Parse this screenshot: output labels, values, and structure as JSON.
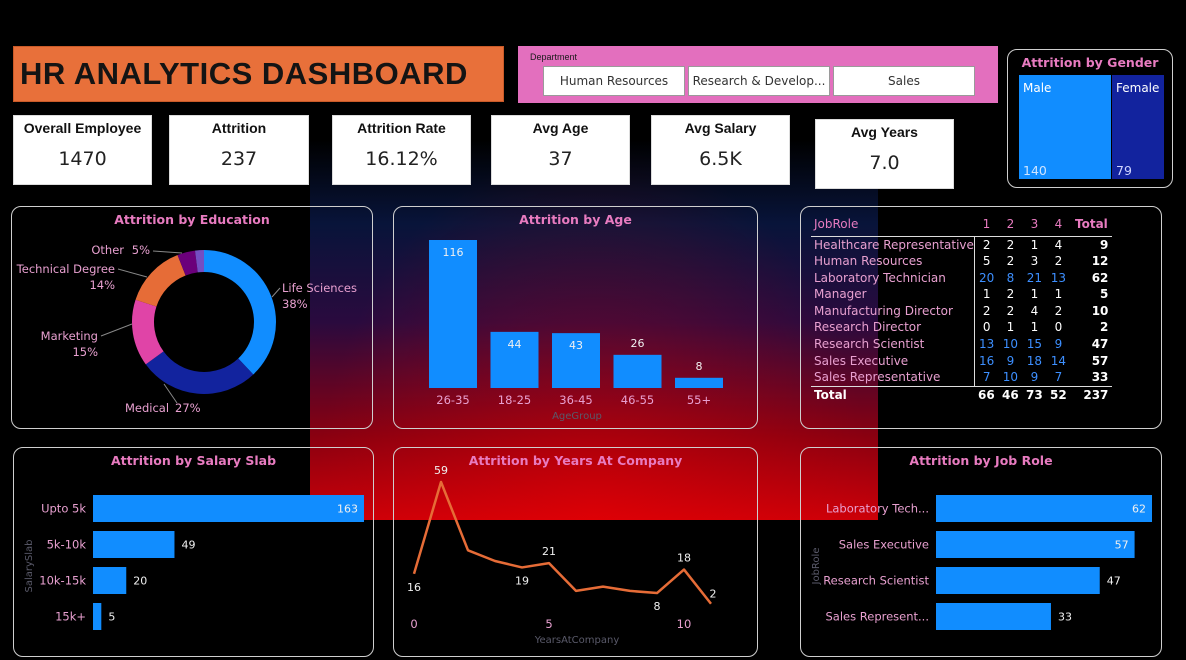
{
  "title": "HR ANALYTICS DASHBOARD",
  "department": {
    "label": "Department",
    "options": [
      "Human Resources",
      "Research & Develop...",
      "Sales"
    ]
  },
  "kpis": [
    {
      "label": "Overall Employee",
      "value": "1470"
    },
    {
      "label": "Attrition",
      "value": "237"
    },
    {
      "label": "Attrition Rate",
      "value": "16.12%"
    },
    {
      "label": "Avg Age",
      "value": "37"
    },
    {
      "label": "Avg Salary",
      "value": "6.5K"
    },
    {
      "label": "Avg Years",
      "value": "7.0"
    }
  ],
  "colors": {
    "title_bg": "#e8703a",
    "slicer_bg": "#e36fbe",
    "accent_pink": "#e87bc0",
    "bar_blue": "#118dff",
    "male_blue": "#118dff",
    "female_blue": "#12239e",
    "line_orange": "#e66c37",
    "highlight_blue": "#3d8fff"
  },
  "gender": {
    "title": "Attrition by Gender",
    "male_label": "Male",
    "male_value": "140",
    "female_label": "Female",
    "female_value": "79"
  },
  "chart_data": [
    {
      "id": "education",
      "type": "pie",
      "title": "Attrition by Education",
      "slices": [
        {
          "name": "Life Sciences",
          "label": "38%",
          "value": 38,
          "color": "#118dff"
        },
        {
          "name": "Medical",
          "label": "27%",
          "value": 27,
          "color": "#12239e"
        },
        {
          "name": "Marketing",
          "label": "15%",
          "value": 15,
          "color": "#e044a7"
        },
        {
          "name": "Technical Degree",
          "label": "14%",
          "value": 14,
          "color": "#e66c37"
        },
        {
          "name": "Other",
          "label": "5%",
          "value": 4,
          "color": "#6b007b"
        },
        {
          "name": "",
          "label": "",
          "value": 2,
          "color": "#744ec2"
        }
      ]
    },
    {
      "id": "age",
      "type": "bar",
      "title": "Attrition by Age",
      "categories": [
        "26-35",
        "18-25",
        "36-45",
        "46-55",
        "55+"
      ],
      "values": [
        116,
        44,
        43,
        26,
        8
      ],
      "xlabel": "AgeGroup",
      "ylim": [
        0,
        116
      ]
    },
    {
      "id": "salary",
      "type": "bar",
      "orientation": "horizontal",
      "title": "Attrition by Salary Slab",
      "categories": [
        "Upto 5k",
        "5k-10k",
        "10k-15k",
        "15k+"
      ],
      "values": [
        163,
        49,
        20,
        5
      ],
      "ylabel": "SalarySlab",
      "xlim": [
        0,
        163
      ]
    },
    {
      "id": "years",
      "type": "line",
      "title": "Attrition by Years At Company",
      "x": [
        0,
        1,
        2,
        3,
        4,
        5,
        6,
        7,
        8,
        9,
        10,
        11
      ],
      "values": [
        16,
        59,
        27,
        22,
        19,
        21,
        8,
        10,
        8,
        7,
        18,
        2
      ],
      "data_labels": [
        {
          "index": 0,
          "text": "16"
        },
        {
          "index": 1,
          "text": "59"
        },
        {
          "index": 4,
          "text": "19"
        },
        {
          "index": 5,
          "text": "21"
        },
        {
          "index": 9,
          "text": "8"
        },
        {
          "index": 10,
          "text": "18"
        },
        {
          "index": 11,
          "text": "2"
        }
      ],
      "x_ticks": [
        {
          "value": 0,
          "text": "0"
        },
        {
          "value": 5,
          "text": "5"
        },
        {
          "value": 10,
          "text": "10"
        }
      ],
      "xlabel": "YearsAtCompany",
      "ylim": [
        0,
        59
      ]
    },
    {
      "id": "jobrole",
      "type": "bar",
      "orientation": "horizontal",
      "title": "Attrition by Job Role",
      "categories": [
        "Laboratory Tech...",
        "Sales Executive",
        "Research Scientist",
        "Sales Represent..."
      ],
      "values": [
        62,
        57,
        47,
        33
      ],
      "ylabel": "JobRole",
      "xlim": [
        0,
        62
      ]
    }
  ],
  "matrix": {
    "headers": [
      "JobRole",
      "1",
      "2",
      "3",
      "4",
      "Total"
    ],
    "rows": [
      {
        "role": "Healthcare Representative",
        "v": [
          "2",
          "2",
          "1",
          "4"
        ],
        "total": "9",
        "hl": false
      },
      {
        "role": "Human Resources",
        "v": [
          "5",
          "2",
          "3",
          "2"
        ],
        "total": "12",
        "hl": false
      },
      {
        "role": "Laboratory Technician",
        "v": [
          "20",
          "8",
          "21",
          "13"
        ],
        "total": "62",
        "hl": true
      },
      {
        "role": "Manager",
        "v": [
          "1",
          "2",
          "1",
          "1"
        ],
        "total": "5",
        "hl": false
      },
      {
        "role": "Manufacturing Director",
        "v": [
          "2",
          "2",
          "4",
          "2"
        ],
        "total": "10",
        "hl": false
      },
      {
        "role": "Research Director",
        "v": [
          "0",
          "1",
          "1",
          "0"
        ],
        "total": "2",
        "hl": false
      },
      {
        "role": "Research Scientist",
        "v": [
          "13",
          "10",
          "15",
          "9"
        ],
        "total": "47",
        "hl": true
      },
      {
        "role": "Sales Executive",
        "v": [
          "16",
          "9",
          "18",
          "14"
        ],
        "total": "57",
        "hl": true
      },
      {
        "role": "Sales Representative",
        "v": [
          "7",
          "10",
          "9",
          "7"
        ],
        "total": "33",
        "hl": true
      }
    ],
    "total_row": {
      "role": "Total",
      "v": [
        "66",
        "46",
        "73",
        "52"
      ],
      "total": "237"
    }
  }
}
